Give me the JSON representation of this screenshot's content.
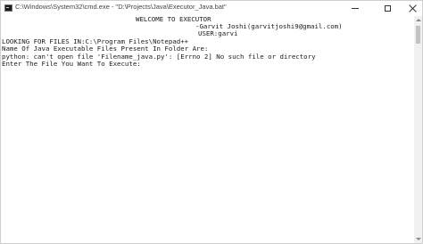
{
  "window": {
    "title": "C:\\Windows\\System32\\cmd.exe - \"D:\\Projects\\Java\\Executor_Java.bat\"",
    "app_icon": "cmd-icon",
    "controls": {
      "minimize_icon": "minimize-icon",
      "maximize_icon": "maximize-icon",
      "close_icon": "close-icon"
    }
  },
  "console": {
    "banner": "WELCOME TO EXECUTOR",
    "author": "-Garvit Joshi(garvitjoshi9@gmail.com)",
    "user": "USER:garvi",
    "looking": "LOOKING FOR FILES IN:C:\\Program Files\\Notepad++",
    "files_header": "Name Of Java Executable Files Present In Folder Are:",
    "error": "python: can't open file 'Filename_java.py': [Errno 2] No such file or directory",
    "prompt": "Enter The File You Want To Execute:"
  }
}
